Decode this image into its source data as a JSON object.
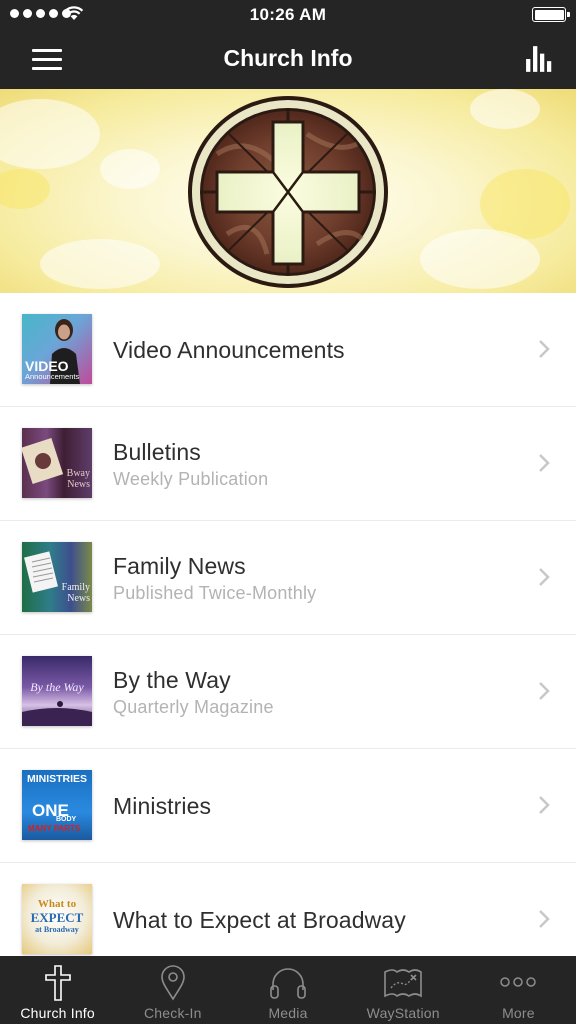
{
  "status_bar": {
    "time": "10:26 AM"
  },
  "nav": {
    "title": "Church Info"
  },
  "list": [
    {
      "label": "Video Announcements",
      "sub": "",
      "thumb": "video-announcements-thumbnail",
      "thumb_text": [
        "VIDEO",
        "Announcements"
      ]
    },
    {
      "label": "Bulletins",
      "sub": "Weekly Publication",
      "thumb": "bulletins-thumbnail",
      "thumb_text": [
        "Bway",
        "News"
      ]
    },
    {
      "label": "Family News",
      "sub": "Published Twice-Monthly",
      "thumb": "family-news-thumbnail",
      "thumb_text": [
        "Family",
        "News"
      ]
    },
    {
      "label": "By the Way",
      "sub": "Quarterly Magazine",
      "thumb": "by-the-way-thumbnail",
      "thumb_text": [
        "By the Way"
      ]
    },
    {
      "label": "Ministries",
      "sub": "",
      "thumb": "ministries-thumbnail",
      "thumb_text": [
        "MINISTRIES",
        "ONE",
        "BODY",
        "MANY PARTS"
      ]
    },
    {
      "label": "What to Expect at Broadway",
      "sub": "",
      "thumb": "what-to-expect-thumbnail",
      "thumb_text": [
        "What to",
        "EXPECT",
        "at Broadway"
      ]
    }
  ],
  "tabs": [
    {
      "label": "Church Info",
      "icon": "cross-icon",
      "active": true
    },
    {
      "label": "Check-In",
      "icon": "map-pin-icon",
      "active": false
    },
    {
      "label": "Media",
      "icon": "headphones-icon",
      "active": false
    },
    {
      "label": "WayStation",
      "icon": "treasure-map-icon",
      "active": false
    },
    {
      "label": "More",
      "icon": "more-dots-icon",
      "active": false
    }
  ],
  "colors": {
    "bar_background": "#252525",
    "tab_active": "#ffffff",
    "tab_inactive": "#8d8d8d",
    "subtitle": "#b3b3b3"
  }
}
